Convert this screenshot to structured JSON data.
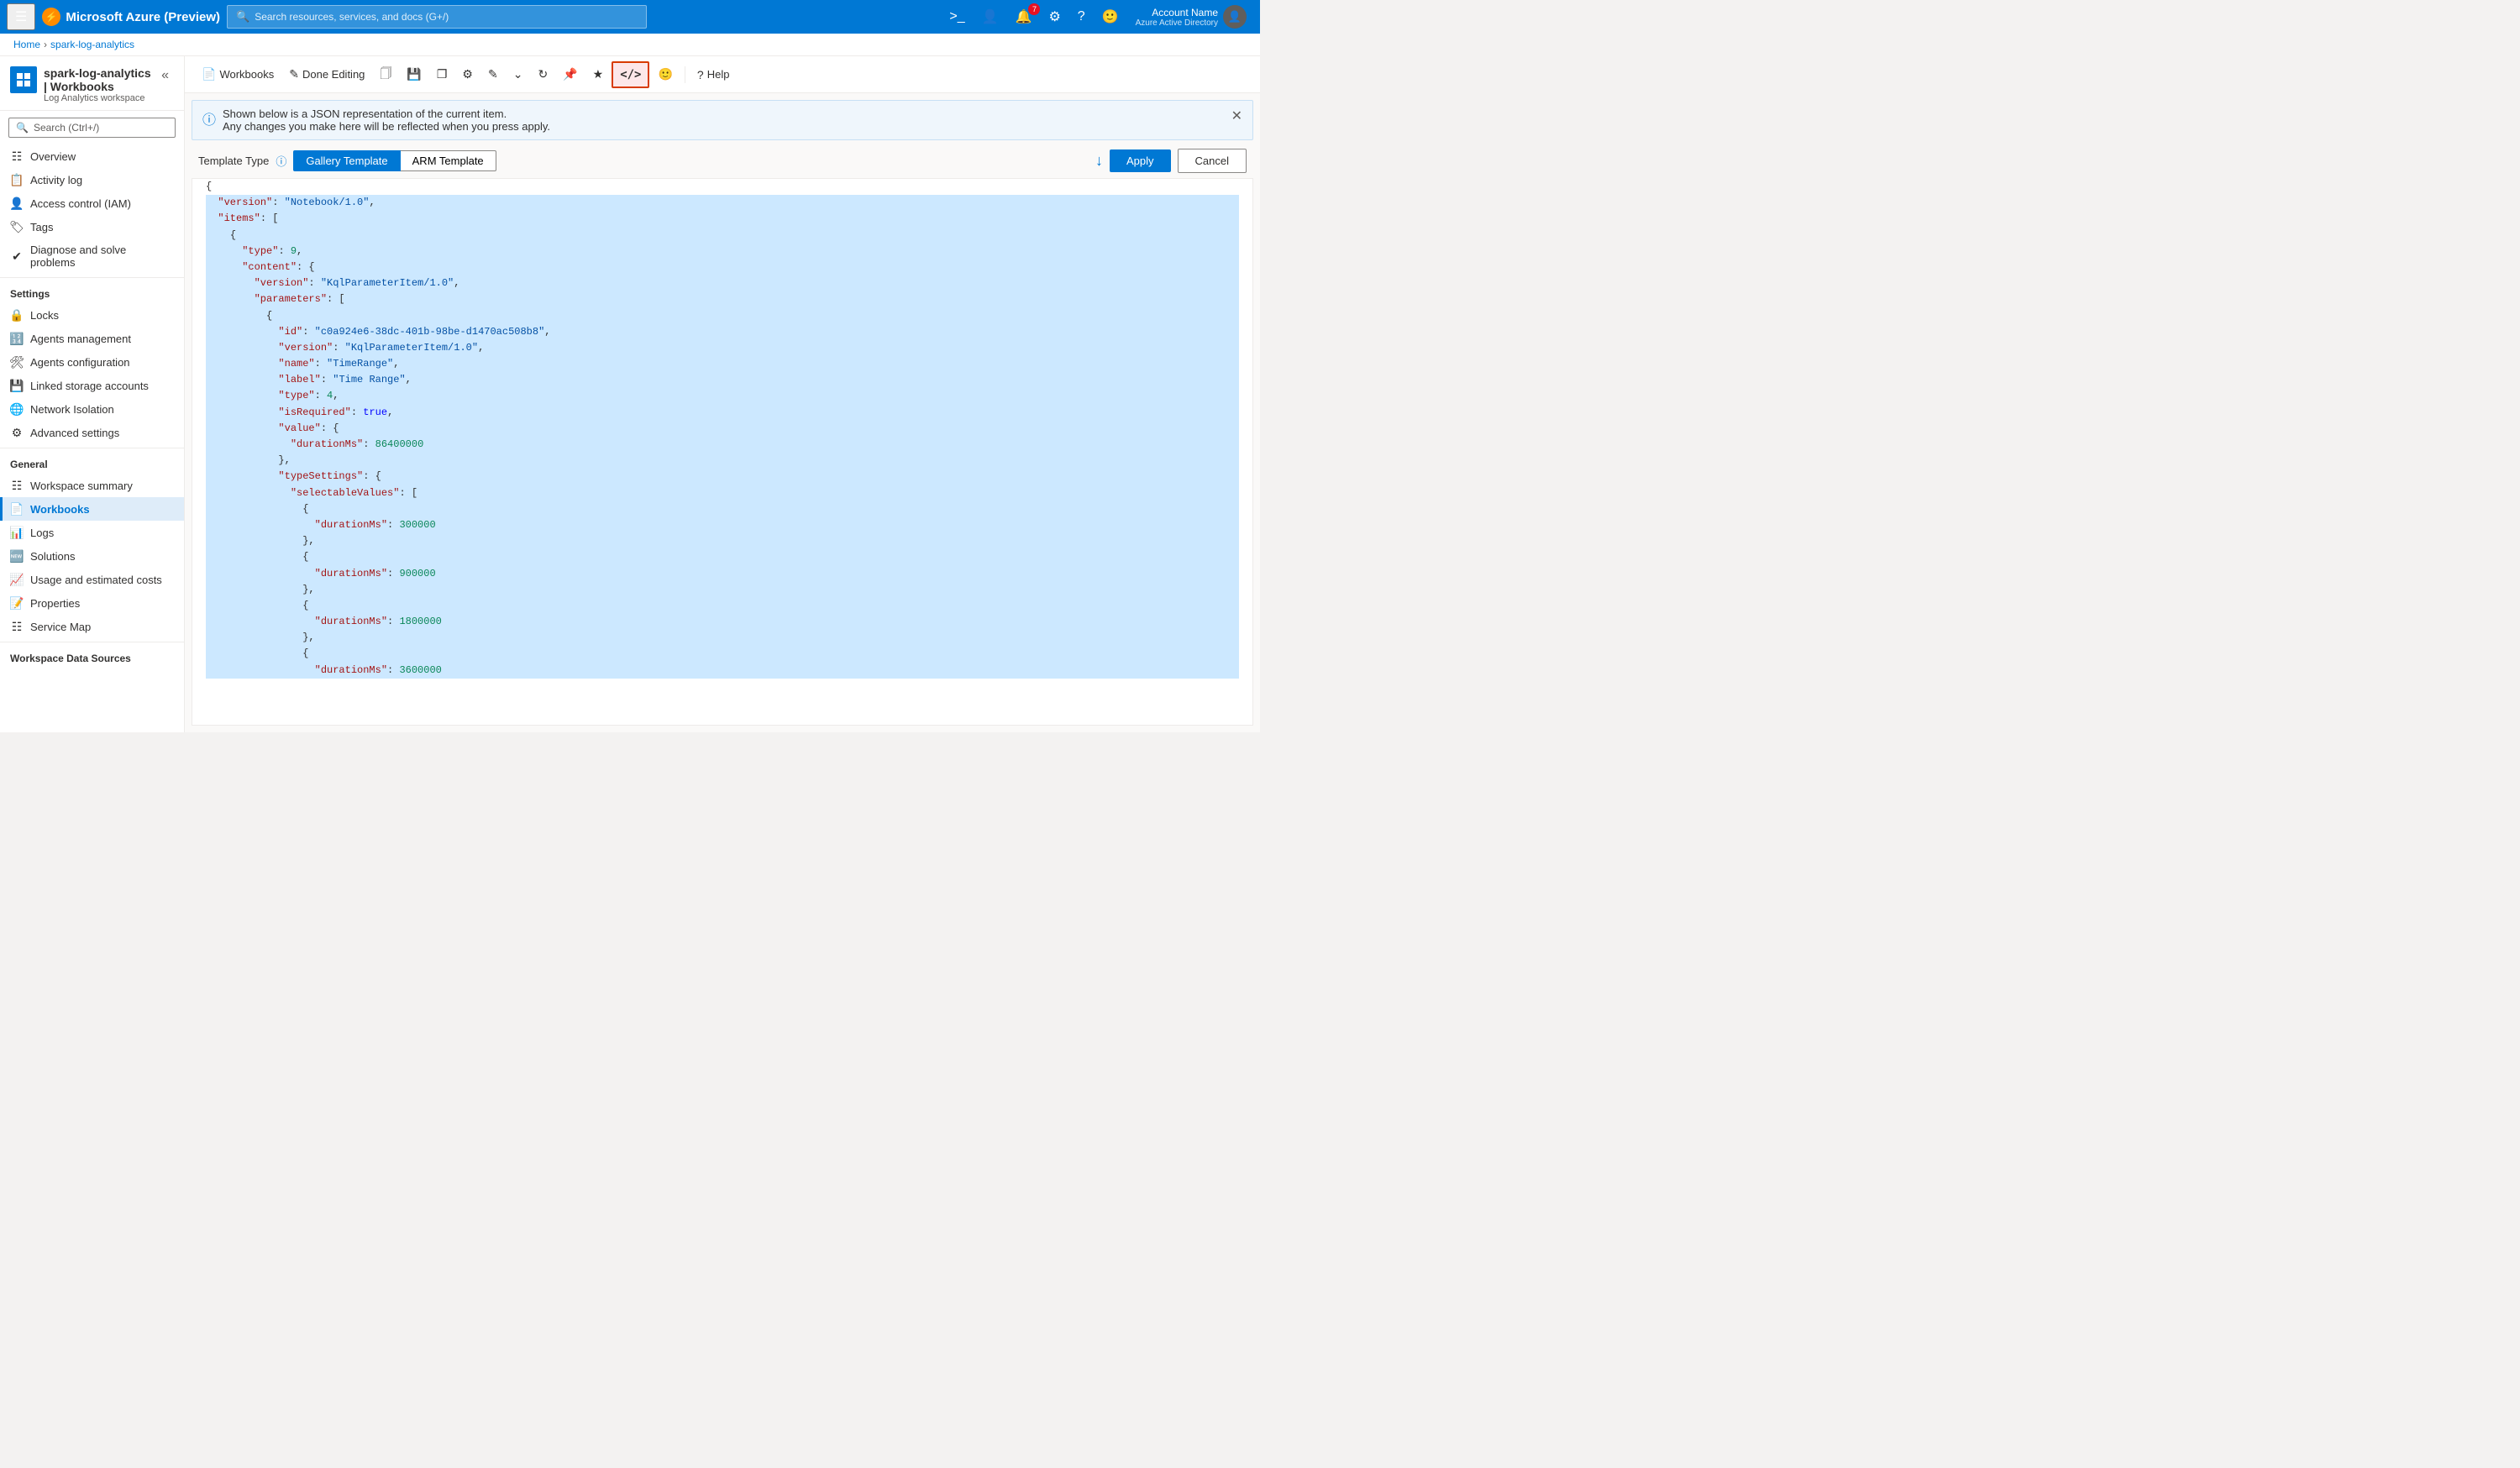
{
  "topbar": {
    "brand": "Microsoft Azure (Preview)",
    "search_placeholder": "Search resources, services, and docs (G+/)",
    "notification_count": "7",
    "account_name": "Account Name",
    "account_subtitle": "Azure Active Directory"
  },
  "breadcrumb": {
    "home": "Home",
    "current": "spark-log-analytics"
  },
  "sidebar": {
    "resource_name": "spark-log-analytics | Workbooks",
    "resource_subtitle": "Log Analytics workspace",
    "search_placeholder": "Search (Ctrl+/)",
    "collapse_label": "Collapse",
    "sections": [
      {
        "label": "",
        "items": [
          {
            "icon": "grid-icon",
            "label": "Overview",
            "active": false
          },
          {
            "icon": "activity-icon",
            "label": "Activity log",
            "active": false
          },
          {
            "icon": "iam-icon",
            "label": "Access control (IAM)",
            "active": false
          },
          {
            "icon": "tag-icon",
            "label": "Tags",
            "active": false
          },
          {
            "icon": "diagnose-icon",
            "label": "Diagnose and solve problems",
            "active": false
          }
        ]
      },
      {
        "label": "Settings",
        "items": [
          {
            "icon": "lock-icon",
            "label": "Locks",
            "active": false
          },
          {
            "icon": "agents-icon",
            "label": "Agents management",
            "active": false
          },
          {
            "icon": "config-icon",
            "label": "Agents configuration",
            "active": false
          },
          {
            "icon": "storage-icon",
            "label": "Linked storage accounts",
            "active": false
          },
          {
            "icon": "network-icon",
            "label": "Network Isolation",
            "active": false
          },
          {
            "icon": "advanced-icon",
            "label": "Advanced settings",
            "active": false
          }
        ]
      },
      {
        "label": "General",
        "items": [
          {
            "icon": "summary-icon",
            "label": "Workspace summary",
            "active": false
          },
          {
            "icon": "workbooks-icon",
            "label": "Workbooks",
            "active": true
          },
          {
            "icon": "logs-icon",
            "label": "Logs",
            "active": false
          },
          {
            "icon": "solutions-icon",
            "label": "Solutions",
            "active": false
          },
          {
            "icon": "usage-icon",
            "label": "Usage and estimated costs",
            "active": false
          },
          {
            "icon": "properties-icon",
            "label": "Properties",
            "active": false
          },
          {
            "icon": "servicemap-icon",
            "label": "Service Map",
            "active": false
          }
        ]
      },
      {
        "label": "Workspace Data Sources",
        "items": []
      }
    ]
  },
  "toolbar": {
    "workbooks_label": "Workbooks",
    "done_editing_label": "Done Editing",
    "code_label": "",
    "help_label": "Help"
  },
  "info_bar": {
    "line1": "Shown below is a JSON representation of the current item.",
    "line2": "Any changes you make here will be reflected when you press apply."
  },
  "template_type": {
    "label": "Template Type",
    "tabs": [
      "Gallery Template",
      "ARM Template"
    ],
    "active_tab": "Gallery Template"
  },
  "actions": {
    "apply_label": "Apply",
    "cancel_label": "Cancel"
  },
  "json_content": {
    "lines": [
      {
        "text": "{",
        "highlight": false
      },
      {
        "text": "  \"version\": \"Notebook/1.0\",",
        "highlight": true
      },
      {
        "text": "  \"items\": [",
        "highlight": true
      },
      {
        "text": "    {",
        "highlight": true
      },
      {
        "text": "      \"type\": 9,",
        "highlight": true
      },
      {
        "text": "      \"content\": {",
        "highlight": true
      },
      {
        "text": "        \"version\": \"KqlParameterItem/1.0\",",
        "highlight": true
      },
      {
        "text": "        \"parameters\": [",
        "highlight": true
      },
      {
        "text": "          {",
        "highlight": true
      },
      {
        "text": "            \"id\": \"c0a924e6-38dc-401b-98be-d1470ac508b8\",",
        "highlight": true
      },
      {
        "text": "            \"version\": \"KqlParameterItem/1.0\",",
        "highlight": true
      },
      {
        "text": "            \"name\": \"TimeRange\",",
        "highlight": true
      },
      {
        "text": "            \"label\": \"Time Range\",",
        "highlight": true
      },
      {
        "text": "            \"type\": 4,",
        "highlight": true
      },
      {
        "text": "            \"isRequired\": true,",
        "highlight": true
      },
      {
        "text": "            \"value\": {",
        "highlight": true
      },
      {
        "text": "              \"durationMs\": 86400000",
        "highlight": true
      },
      {
        "text": "            },",
        "highlight": true
      },
      {
        "text": "            \"typeSettings\": {",
        "highlight": true
      },
      {
        "text": "              \"selectableValues\": [",
        "highlight": true
      },
      {
        "text": "                {",
        "highlight": true
      },
      {
        "text": "                  \"durationMs\": 300000",
        "highlight": true
      },
      {
        "text": "                },",
        "highlight": true
      },
      {
        "text": "                {",
        "highlight": true
      },
      {
        "text": "                  \"durationMs\": 900000",
        "highlight": true
      },
      {
        "text": "                },",
        "highlight": true
      },
      {
        "text": "                {",
        "highlight": true
      },
      {
        "text": "                  \"durationMs\": 1800000",
        "highlight": true
      },
      {
        "text": "                },",
        "highlight": true
      },
      {
        "text": "                {",
        "highlight": true
      },
      {
        "text": "                  \"durationMs\": 3600000",
        "highlight": true
      }
    ]
  }
}
